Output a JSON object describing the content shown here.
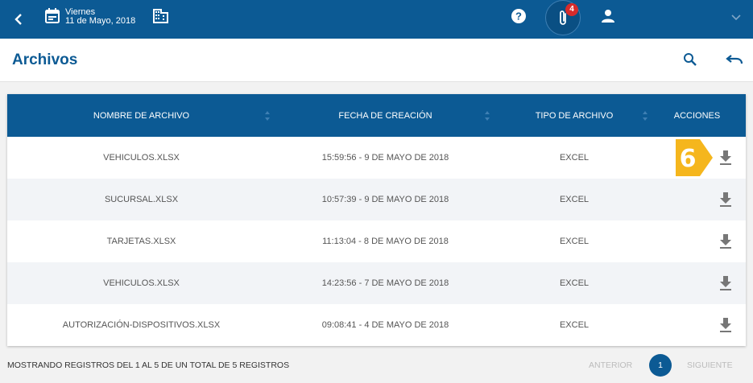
{
  "topbar": {
    "day": "Viernes",
    "date": "11 de Mayo, 2018",
    "notification_count": "4"
  },
  "header": {
    "title": "Archivos"
  },
  "table": {
    "columns": [
      "NOMBRE DE ARCHIVO",
      "FECHA DE CREACIÓN",
      "TIPO DE ARCHIVO",
      "ACCIONES"
    ],
    "rows": [
      {
        "name": "VEHICULOS.XLSX",
        "date": "15:59:56 - 9 DE MAYO DE 2018",
        "type": "EXCEL"
      },
      {
        "name": "SUCURSAL.XLSX",
        "date": "10:57:39 - 9 DE MAYO DE 2018",
        "type": "EXCEL"
      },
      {
        "name": "TARJETAS.XLSX",
        "date": "11:13:04 - 8 DE MAYO DE 2018",
        "type": "EXCEL"
      },
      {
        "name": "VEHICULOS.XLSX",
        "date": "14:23:56 - 7 DE MAYO DE 2018",
        "type": "EXCEL"
      },
      {
        "name": "AUTORIZACIÓN-DISPOSITIVOS.XLSX",
        "date": "09:08:41 - 4 DE MAYO DE 2018",
        "type": "EXCEL"
      }
    ]
  },
  "annotation": {
    "step": "6",
    "color": "#f5b61d"
  },
  "footer": {
    "info": "MOSTRANDO REGISTROS DEL 1 AL 5 DE UN TOTAL DE 5 REGISTROS",
    "prev": "ANTERIOR",
    "page": "1",
    "next": "SIGUIENTE"
  },
  "colors": {
    "primary": "#0c5a94",
    "badge": "#d62b2b"
  }
}
